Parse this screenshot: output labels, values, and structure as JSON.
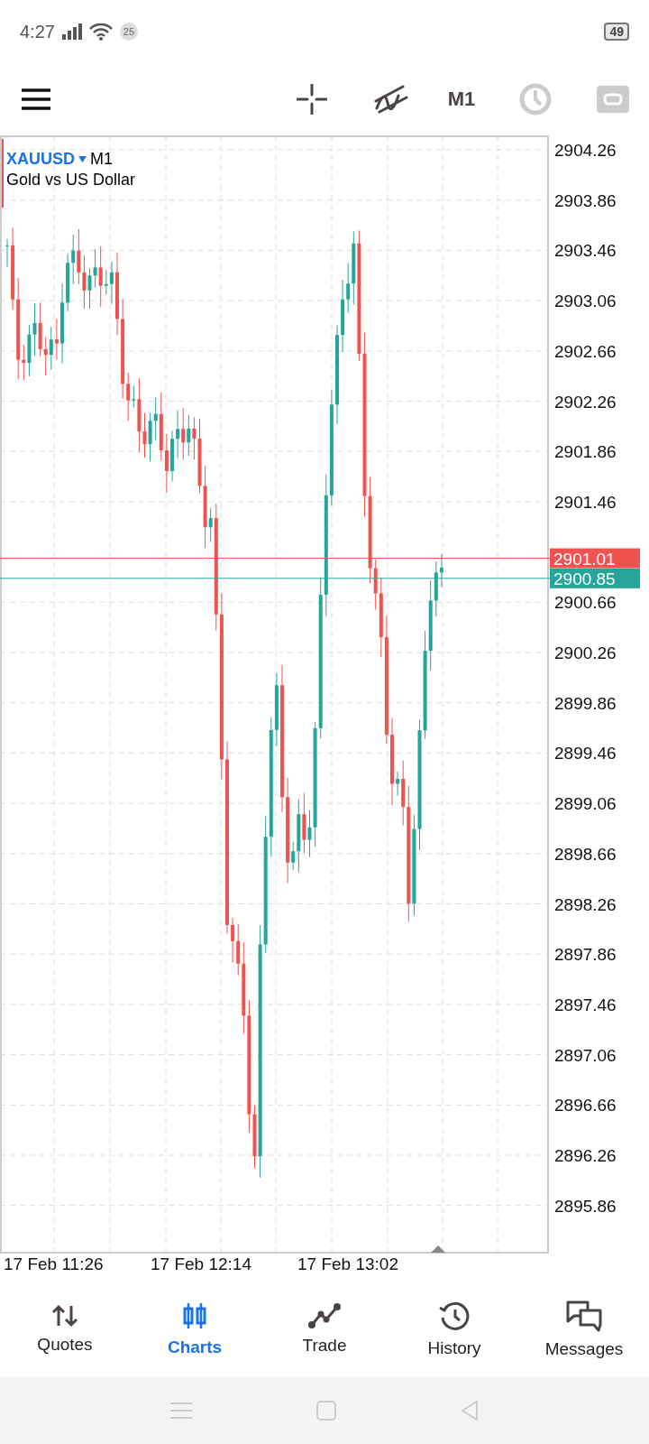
{
  "status_bar": {
    "time": "4:27",
    "notification_count": "25",
    "battery": "49"
  },
  "toolbar": {
    "timeframe": "M1"
  },
  "chart": {
    "symbol": "XAUUSD",
    "timeframe": "M1",
    "description": "Gold vs US Dollar",
    "price_labels": [
      "2904.26",
      "2903.86",
      "2903.46",
      "2903.06",
      "2902.66",
      "2902.26",
      "2901.86",
      "2901.46",
      "2900.66",
      "2900.26",
      "2899.86",
      "2899.46",
      "2899.06",
      "2898.66",
      "2898.26",
      "2897.86",
      "2897.46",
      "2897.06",
      "2896.66",
      "2896.26",
      "2895.86"
    ],
    "bid_tag": "2901.01",
    "ask_tag": "2900.85",
    "time_labels": [
      "17 Feb 11:26",
      "17 Feb 12:14",
      "17 Feb 13:02"
    ]
  },
  "bottom_nav": [
    {
      "label": "Quotes",
      "kind": "quotes",
      "selected": false
    },
    {
      "label": "Charts",
      "kind": "charts",
      "selected": true
    },
    {
      "label": "Trade",
      "kind": "trade",
      "selected": false
    },
    {
      "label": "History",
      "kind": "history",
      "selected": false
    },
    {
      "label": "Messages",
      "kind": "messages",
      "selected": false
    }
  ]
}
